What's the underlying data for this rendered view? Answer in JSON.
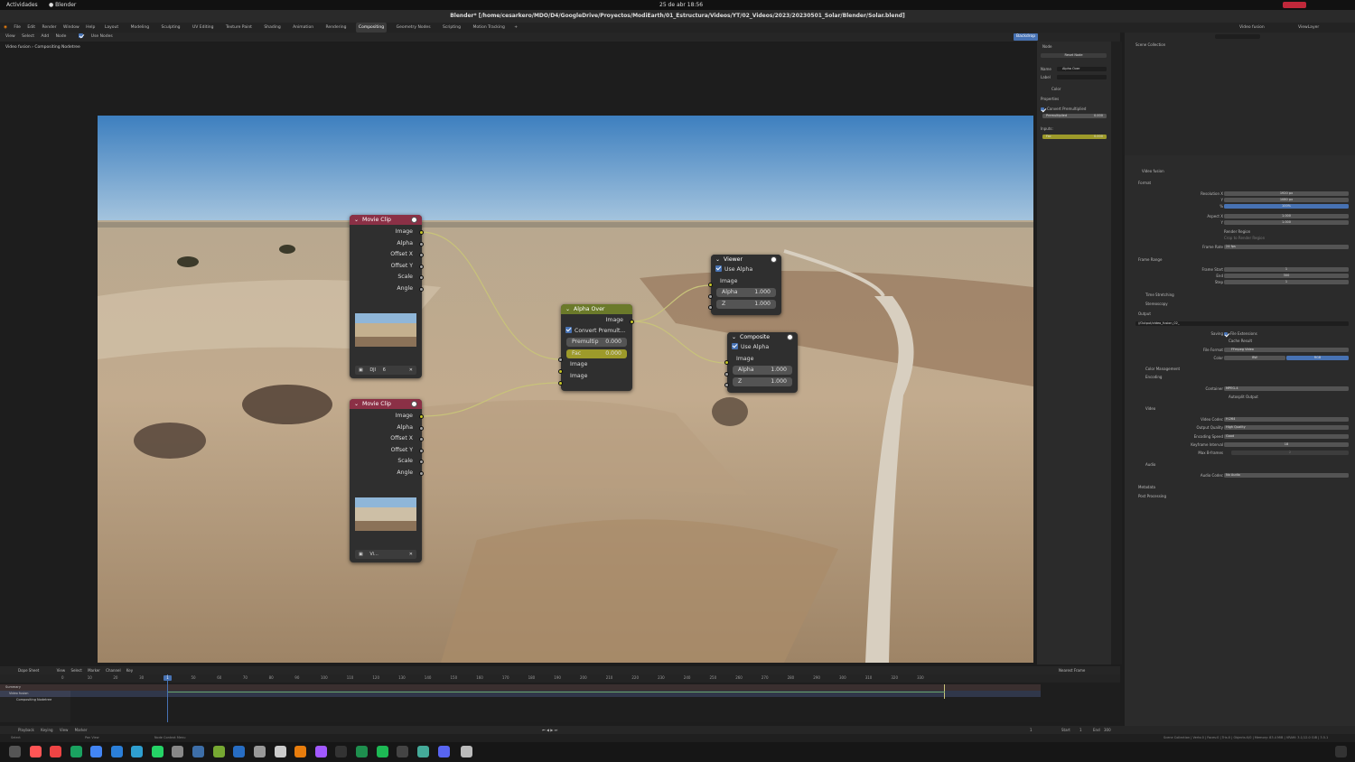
{
  "system_bar": {
    "activities": "Actividades",
    "app_name": "Blender",
    "datetime": "25 de abr 18:56"
  },
  "window_title": "Blender* [/home/cesarkero/MDO/D4/GoogleDrive/Proyectos/ModiEarth/01_Estructura/Videos/YT/02_Videos/2023/20230501_Solar/Blender/Solar.blend]",
  "menu": {
    "items": [
      "File",
      "Edit",
      "Render",
      "Window",
      "Help"
    ],
    "workspaces": [
      "Layout",
      "Modeling",
      "Sculpting",
      "UV Editing",
      "Texture Paint",
      "Shading",
      "Animation",
      "Rendering",
      "Compositing",
      "Geometry Nodes",
      "Scripting",
      "Motion Tracking"
    ],
    "active_workspace": "Compositing"
  },
  "editor_header": {
    "items": [
      "View",
      "Select",
      "Add",
      "Node"
    ],
    "use_nodes": "Use Nodes",
    "backdrop": "Backdrop"
  },
  "breadcrumb": {
    "scene": "Video fusion",
    "tree": "Compositing Nodetree"
  },
  "nodes": {
    "movie_clip_1": {
      "title": "Movie Clip",
      "outputs": [
        "Image",
        "Alpha",
        "Offset X",
        "Offset Y",
        "Scale",
        "Angle"
      ],
      "clip_name": "DJI",
      "users": "6"
    },
    "movie_clip_2": {
      "title": "Movie Clip",
      "outputs": [
        "Image",
        "Alpha",
        "Offset X",
        "Offset Y",
        "Scale",
        "Angle"
      ],
      "clip_name": "Vi..."
    },
    "alpha_over": {
      "title": "Alpha Over",
      "output": "Image",
      "convert": "Convert Premult...",
      "premultip_label": "Premultip",
      "premultip_value": "0.000",
      "fac_label": "Fac",
      "fac_value": "0.000",
      "inputs": [
        "Image",
        "Image"
      ]
    },
    "viewer": {
      "title": "Viewer",
      "use_alpha": "Use Alpha",
      "input": "Image",
      "alpha_label": "Alpha",
      "alpha_value": "1.000",
      "z_label": "Z",
      "z_value": "1.000"
    },
    "composite": {
      "title": "Composite",
      "use_alpha": "Use Alpha",
      "input": "Image",
      "alpha_label": "Alpha",
      "alpha_value": "1.000",
      "z_label": "Z",
      "z_value": "1.000"
    }
  },
  "npanel": {
    "section": "Node",
    "reset": "Reset Node",
    "name_label": "Name",
    "name_value": "Alpha Over",
    "label_label": "Label",
    "color": "Color",
    "properties": "Properties",
    "convert": "Convert Premultiplied",
    "premultiplied_label": "Premultiplied",
    "premultiplied_value": "0.000",
    "inputs": "Inputs:",
    "fac_label": "Fac",
    "fac_value": "0.000"
  },
  "outliner": {
    "scene_collection": "Scene Collection",
    "scene": "Video fusion",
    "view_layer": "ViewLayer"
  },
  "properties": {
    "scene": "Video fusion",
    "format": "Format",
    "resolution_x_label": "Resolution X",
    "resolution_x": "1920 px",
    "resolution_y_label": "Y",
    "resolution_y": "1080 px",
    "percent_label": "%",
    "percent": "100%",
    "aspect_x_label": "Aspect X",
    "aspect_x": "1.000",
    "aspect_y_label": "Y",
    "aspect_y": "1.000",
    "render_region": "Render Region",
    "crop": "Crop to Render Region",
    "frame_rate_label": "Frame Rate",
    "frame_rate": "24 fps",
    "frame_range": "Frame Range",
    "frame_start_label": "Frame Start",
    "frame_start": "1",
    "end_label": "End",
    "end": "300",
    "step_label": "Step",
    "step": "1",
    "time_stretching": "Time Stretching",
    "stereoscopy": "Stereoscopy",
    "output": "Output",
    "output_path": "//Output/video_fusion_02_",
    "saving_label": "Saving",
    "file_extensions": "File Extensions",
    "cache_result": "Cache Result",
    "file_format_label": "File Format",
    "file_format": "FFmpeg Video",
    "color_label": "Color",
    "color_bw": "BW",
    "color_rgb": "RGB",
    "color_management": "Color Management",
    "encoding": "Encoding",
    "container_label": "Container",
    "container": "MPEG-4",
    "autosplit": "Autosplit Output",
    "video": "Video",
    "video_codec_label": "Video Codec",
    "video_codec": "H.264",
    "output_quality_label": "Output Quality",
    "output_quality": "High Quality",
    "encoding_speed_label": "Encoding Speed",
    "encoding_speed": "Good",
    "keyframe_label": "Keyframe Interval",
    "keyframe": "18",
    "max_bframes_label": "Max B-frames",
    "max_bframes": "2",
    "audio": "Audio",
    "audio_codec_label": "Audio Codec",
    "audio_codec": "No Audio",
    "metadata": "Metadata",
    "post_processing": "Post Processing"
  },
  "timeline": {
    "editor": "Dope Sheet",
    "menu": [
      "View",
      "Select",
      "Marker",
      "Channel",
      "Key"
    ],
    "nearest_frame": "Nearest Frame",
    "summary": "Summary",
    "scene": "Video fusion",
    "tree": "Compositing Nodetree",
    "ruler": [
      "0",
      "10",
      "20",
      "30",
      "40",
      "50",
      "60",
      "70",
      "80",
      "90",
      "100",
      "110",
      "120",
      "130",
      "140",
      "150",
      "160",
      "170",
      "180",
      "190",
      "200",
      "210",
      "220",
      "230",
      "240",
      "250",
      "260",
      "270",
      "280",
      "290",
      "300",
      "310",
      "320",
      "330"
    ],
    "current_frame": "1"
  },
  "playback": {
    "items": [
      "Playback",
      "Keying",
      "View",
      "Marker"
    ],
    "frame": "1",
    "start_label": "Start",
    "start": "1",
    "end_label": "End",
    "end": "300"
  },
  "statusbar": {
    "select": "Select",
    "pan": "Pan View",
    "context": "Node Context Menu",
    "stats": "Scene Collection | Verts:0 | Faces:0 | Tris:0 | Objects:0/0 | Memory: 83.4 MiB | VRAM: 3.1/12.0 GiB | 3.5.1"
  },
  "colors": {
    "accent_blue": "#4772b3",
    "movie_clip_header": "#8b3046",
    "alpha_over_header": "#6b7a2a",
    "viewer_header": "#2f2f2f",
    "node_link": "#c8c37a"
  }
}
